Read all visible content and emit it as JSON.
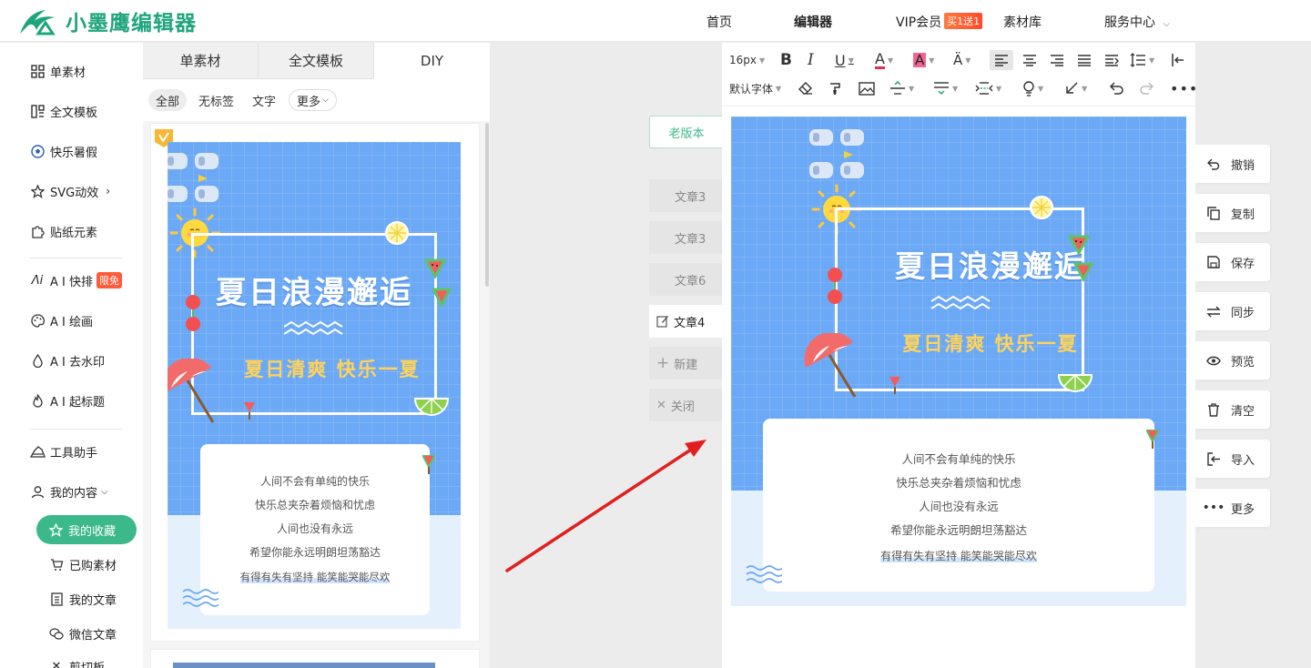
{
  "header": {
    "brand": "小墨鹰编辑器",
    "nav": {
      "home": "首页",
      "editor": "编辑器",
      "vip": "VIP会员",
      "vip_badge": "买1送1",
      "materials": "素材库",
      "service": "服务中心"
    }
  },
  "sidebar": {
    "items": {
      "single": "单素材",
      "fulltext": "全文模板",
      "summer": "快乐暑假",
      "svg": "SVG动效",
      "sticker": "贴纸元素",
      "ai_layout": "A I 快排",
      "ai_layout_badge": "限免",
      "ai_paint": "A I 绘画",
      "ai_watermark": "A I 去水印",
      "ai_title": "A I 起标题",
      "tools": "工具助手",
      "mine": "我的内容"
    },
    "sub": {
      "favorites": "我的收藏",
      "purchased": "已购素材",
      "articles": "我的文章",
      "wechat": "微信文章",
      "clipboard": "剪切板"
    }
  },
  "panel": {
    "tabs": [
      "单素材",
      "全文模板",
      "DIY"
    ],
    "filters": [
      "全部",
      "无标签",
      "文字",
      "更多"
    ]
  },
  "poster": {
    "title": "夏日浪漫邂逅",
    "subtitle": "夏日清爽  快乐一夏",
    "lines": [
      "人间不会有单纯的快乐",
      "快乐总夹杂着烦恼和忧虑",
      "人间也没有永远",
      "希望你能永远明朗坦荡豁达",
      "有得有失有坚持  能笑能哭能尽欢"
    ]
  },
  "articles": {
    "old_version": "老版本",
    "tabs": [
      "文章3",
      "文章3",
      "文章6",
      "文章4"
    ],
    "new": "新建",
    "close": "关闭"
  },
  "toolbar": {
    "font_size": "16px",
    "font_family": "默认字体"
  },
  "actions": [
    "撤销",
    "复制",
    "保存",
    "同步",
    "预览",
    "清空",
    "导入",
    "更多"
  ],
  "colors": {
    "brand": "#1fa57c",
    "accent": "#3cb98b",
    "poster_sky": "#6ba8f5",
    "poster_title_sub": "#ffd35a",
    "arrow": "#e02020"
  }
}
